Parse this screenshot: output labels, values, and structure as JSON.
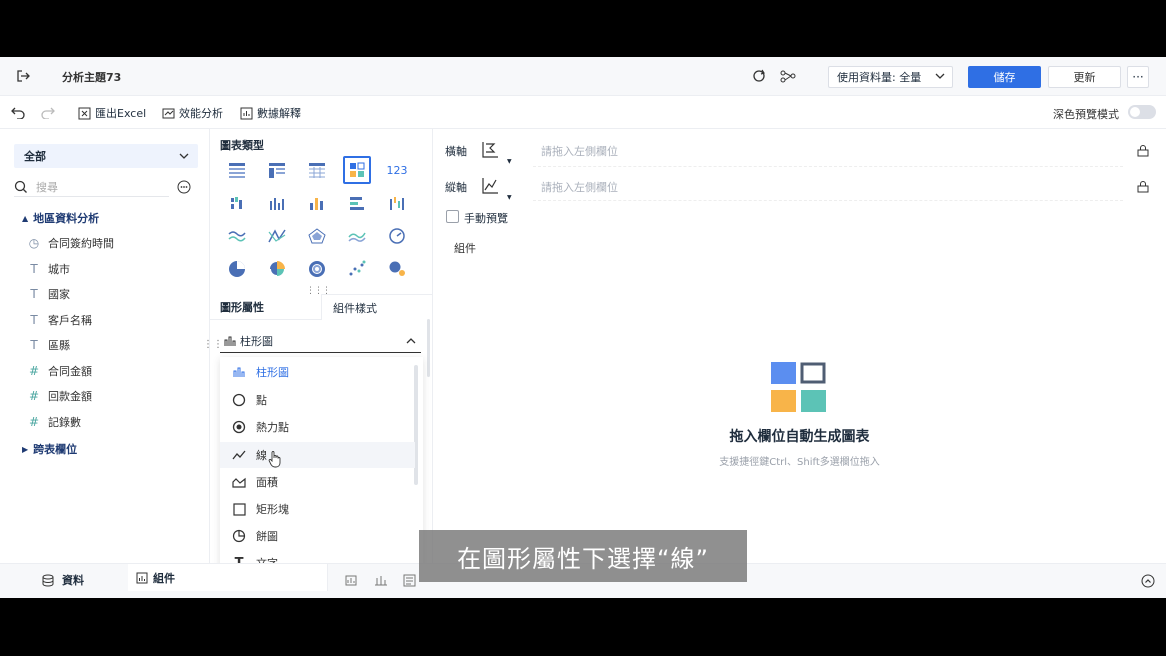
{
  "topbar": {
    "title": "分析主題73",
    "data_volume": "使用資料量: 全量",
    "save_label": "儲存",
    "update_label": "更新",
    "more_label": "···"
  },
  "toolbar": {
    "export_label": "匯出Excel",
    "perf_label": "效能分析",
    "explain_label": "數據解釋",
    "dark_preview_label": "深色預覽模式"
  },
  "left": {
    "dropdown_value": "全部",
    "search_placeholder": "搜尋",
    "group1": "地區資料分析",
    "fields": [
      {
        "icon": "◷",
        "label": "合同簽約時間"
      },
      {
        "icon": "T",
        "label": "城市"
      },
      {
        "icon": "T",
        "label": "國家"
      },
      {
        "icon": "T",
        "label": "客戶名稱"
      },
      {
        "icon": "T",
        "label": "區縣"
      },
      {
        "icon": "#",
        "label": "合同金額"
      },
      {
        "icon": "#",
        "label": "回款金額"
      },
      {
        "icon": "#",
        "label": "記錄數"
      }
    ],
    "group2": "跨表欄位"
  },
  "mid": {
    "chart_types_title": "圖表類型",
    "tab_props": "圖形屬性",
    "tab_style": "組件樣式",
    "selected_type": "柱形圖",
    "options": [
      "柱形圖",
      "點",
      "熱力點",
      "線",
      "面積",
      "矩形塊",
      "餅圖",
      "文字"
    ]
  },
  "right": {
    "x_axis_label": "橫軸",
    "y_axis_label": "縱軸",
    "drop_hint": "請拖入左側欄位",
    "manual_preview": "手動預覽",
    "component_label": "組件",
    "empty_title": "拖入欄位自動生成圖表",
    "empty_sub": "支援捷徑鍵Ctrl、Shift多選欄位拖入"
  },
  "bottom": {
    "data_tab": "資料",
    "component_tab": "組件"
  },
  "caption": "在圖形屬性下選擇“線”",
  "colors": {
    "primary": "#2f6fe4",
    "brand_blue": "#5b8ef0",
    "brand_orange": "#f8b449",
    "brand_teal": "#5cc3b6"
  }
}
